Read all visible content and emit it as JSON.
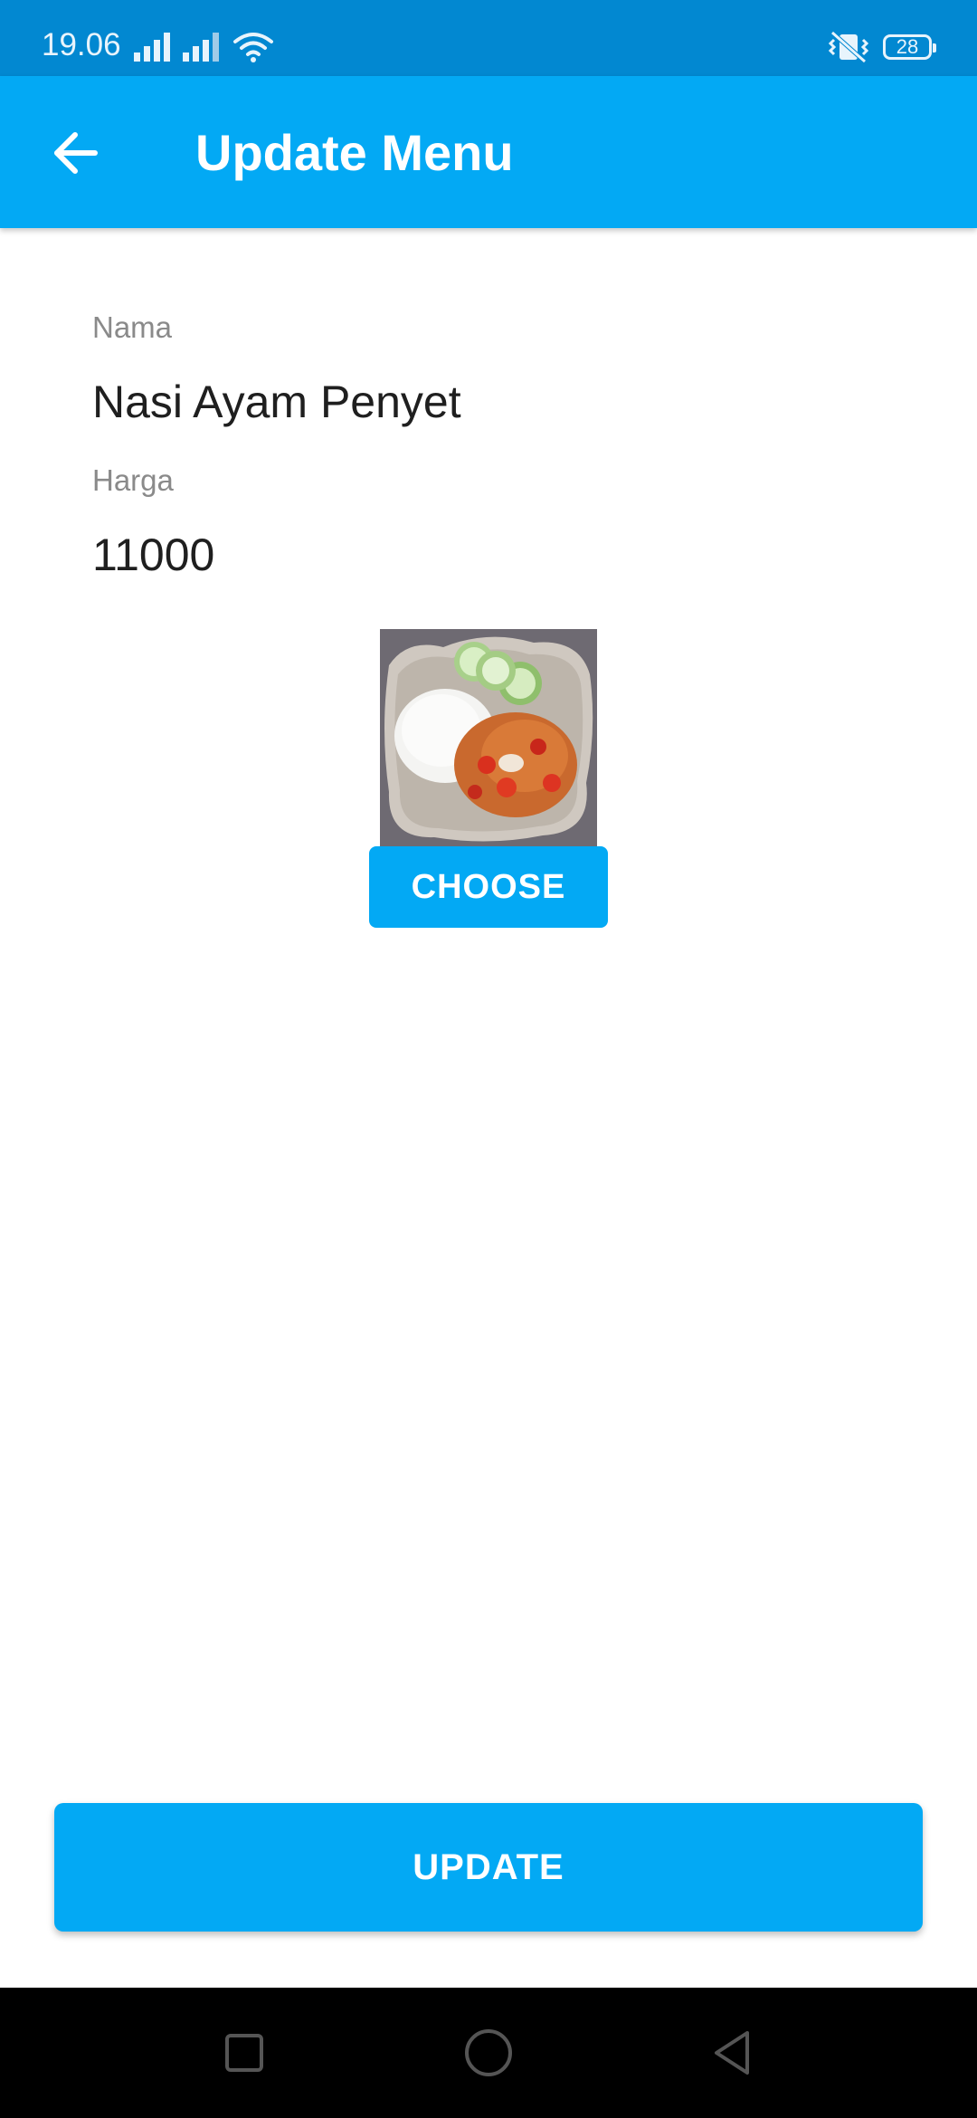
{
  "status_bar": {
    "time": "19.06",
    "battery": "28",
    "icons": [
      "signal-icon",
      "signal-icon",
      "wifi-icon",
      "vibrate-icon",
      "battery-icon"
    ]
  },
  "app_bar": {
    "title": "Update Menu",
    "back_icon": "arrow-back-icon",
    "color": "#03a9f4"
  },
  "form": {
    "name_label": "Nama",
    "name_value": "Nasi Ayam Penyet",
    "price_label": "Harga",
    "price_value": "11000",
    "choose_label": "CHOOSE"
  },
  "update_button": {
    "label": "UPDATE"
  },
  "colors": {
    "primary": "#03a9f4",
    "primary_dark": "#0288d1"
  },
  "nav_bar": {
    "icons": [
      "recent-apps-icon",
      "home-icon",
      "back-icon"
    ]
  }
}
